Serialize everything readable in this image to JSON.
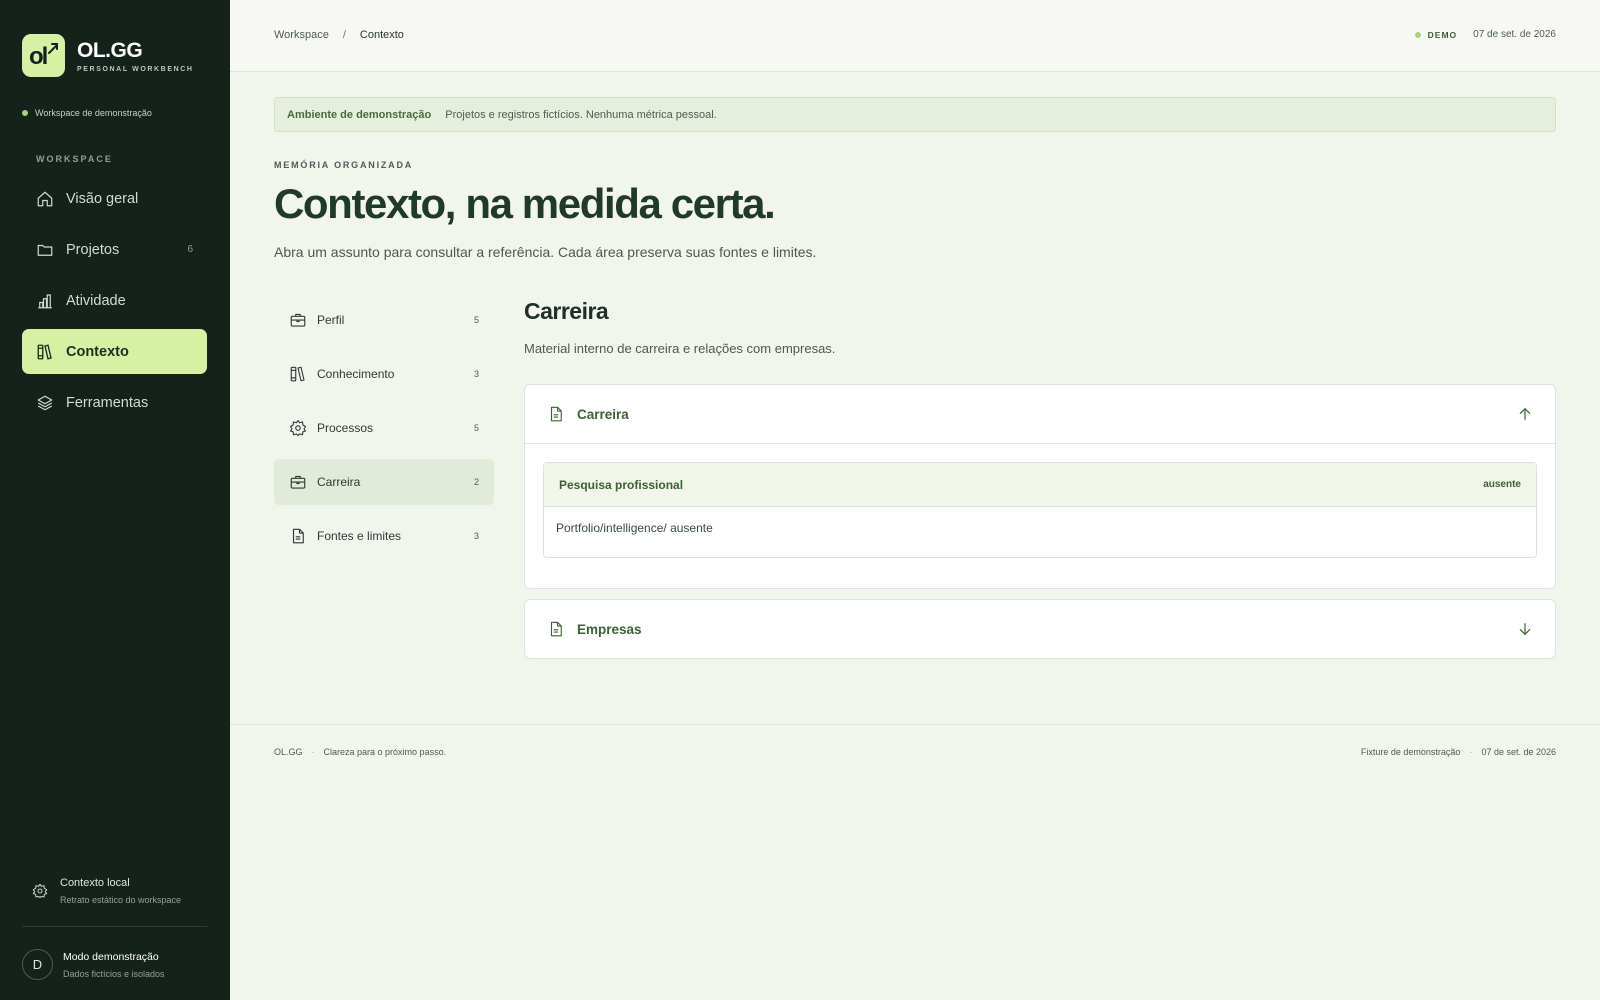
{
  "brand": {
    "logo_text": "ol",
    "name": "OL.GG",
    "subtitle": "PERSONAL WORKBENCH",
    "accent": "#d6f0a4"
  },
  "sidebar": {
    "workspace_status": "Workspace de demonstração",
    "section_label": "WORKSPACE",
    "items": [
      {
        "label": "Visão geral",
        "icon": "home-icon",
        "count": ""
      },
      {
        "label": "Projetos",
        "icon": "folder-icon",
        "count": "6"
      },
      {
        "label": "Atividade",
        "icon": "bar-chart-icon",
        "count": ""
      },
      {
        "label": "Contexto",
        "icon": "books-icon",
        "count": "",
        "active": true
      },
      {
        "label": "Ferramentas",
        "icon": "layers-icon",
        "count": ""
      }
    ],
    "local": {
      "title": "Contexto local",
      "subtitle": "Retrato estático do workspace"
    },
    "user": {
      "initial": "D",
      "title": "Modo demonstração",
      "subtitle": "Dados fictícios e isolados"
    }
  },
  "topbar": {
    "breadcrumb": [
      "Workspace",
      "Contexto"
    ],
    "breadcrumb_sep": "/",
    "badge": "DEMO",
    "date": "07 de set. de 2026"
  },
  "banner": {
    "title": "Ambiente de demonstração",
    "text": "Projetos e registros fictícios. Nenhuma métrica pessoal."
  },
  "hero": {
    "eyebrow": "MEMÓRIA ORGANIZADA",
    "title": "Contexto, na medida certa.",
    "subtitle": "Abra um assunto para consultar a referência. Cada área preserva suas fontes e limites."
  },
  "subnav": [
    {
      "label": "Perfil",
      "icon": "briefcase-icon",
      "count": "5"
    },
    {
      "label": "Conhecimento",
      "icon": "books-icon",
      "count": "3"
    },
    {
      "label": "Processos",
      "icon": "gear-icon",
      "count": "5"
    },
    {
      "label": "Carreira",
      "icon": "briefcase-icon",
      "count": "2",
      "active": true
    },
    {
      "label": "Fontes e limites",
      "icon": "document-icon",
      "count": "3"
    }
  ],
  "detail": {
    "title": "Carreira",
    "description": "Material interno de carreira e relações com empresas.",
    "sections": [
      {
        "title": "Carreira",
        "expanded": true,
        "entries": [
          {
            "title": "Pesquisa profissional",
            "status": "ausente",
            "body": "Portfolio/intelligence/ ausente"
          }
        ]
      },
      {
        "title": "Empresas",
        "expanded": false
      }
    ]
  },
  "footer": {
    "left": [
      "OL.GG",
      "Clareza para o próximo passo."
    ],
    "sep": "·",
    "right": [
      "Fixture de demonstração",
      "07 de set. de 2026"
    ]
  }
}
